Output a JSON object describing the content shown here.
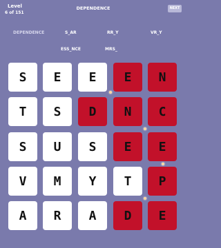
{
  "header": {
    "level_label": "Level",
    "level_count": "6 of 151",
    "target_word": "DEPENDENCE",
    "next_label": "NEXT"
  },
  "hints": [
    "DEPENDENCE",
    "S_AR",
    "RR_Y",
    "VR_Y",
    "ESS_NCE",
    "MRS_"
  ],
  "grid": {
    "rows": [
      [
        "S",
        "E",
        "E",
        "E",
        "N"
      ],
      [
        "T",
        "S",
        "D",
        "N",
        "C"
      ],
      [
        "S",
        "U",
        "S",
        "E",
        "E"
      ],
      [
        "V",
        "M",
        "Y",
        "T",
        "P"
      ],
      [
        "A",
        "R",
        "A",
        "D",
        "E"
      ]
    ]
  },
  "colors": {
    "background": "#7a7aac",
    "tile": "#ffffff",
    "highlight": "#c2112a",
    "letter": "#111111"
  }
}
